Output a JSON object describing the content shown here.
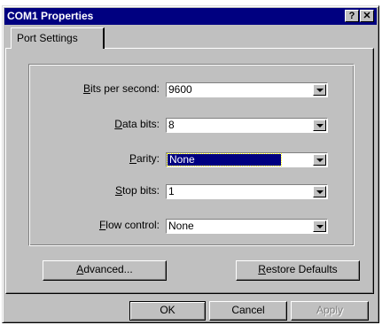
{
  "window": {
    "title": "COM1 Properties"
  },
  "titlebar": {
    "help_label": "?",
    "close_label": "✕"
  },
  "tabs": [
    {
      "label": "Port Settings"
    }
  ],
  "fields": {
    "bits_per_second": {
      "label_u": "B",
      "label_rest": "its per second:",
      "value": "9600"
    },
    "data_bits": {
      "label_u": "D",
      "label_rest": "ata bits:",
      "value": "8"
    },
    "parity": {
      "label_pre": "",
      "label_u": "P",
      "label_rest": "arity:",
      "value": "None"
    },
    "stop_bits": {
      "label_u": "S",
      "label_rest": "top bits:",
      "value": "1"
    },
    "flow_control": {
      "label_u": "F",
      "label_rest": "low control:",
      "value": "None"
    }
  },
  "buttons": {
    "advanced": {
      "label_u": "A",
      "label_rest": "dvanced..."
    },
    "restore": {
      "label_u": "R",
      "label_rest": "estore Defaults"
    },
    "ok": "OK",
    "cancel": "Cancel",
    "apply": "Apply"
  }
}
